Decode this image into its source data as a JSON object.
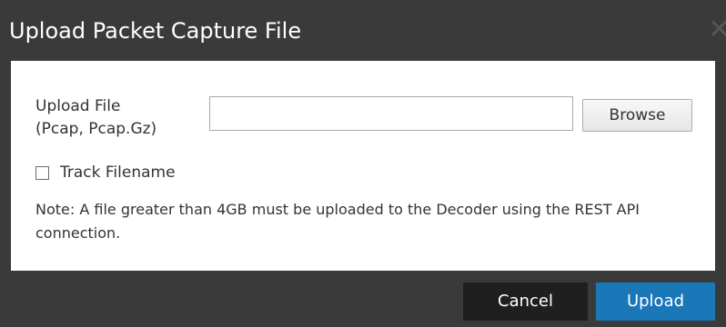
{
  "dialog": {
    "title": "Upload Packet Capture File",
    "close_icon": "close-icon",
    "close_glyph": "✕"
  },
  "form": {
    "upload_label_line1": "Upload File",
    "upload_label_line2": "(Pcap, Pcap.Gz)",
    "file_value": "",
    "browse_label": "Browse",
    "track_filename_label": "Track Filename",
    "track_filename_checked": false,
    "note": "Note: A file greater than 4GB must be uploaded to the Decoder using the REST API connection."
  },
  "footer": {
    "cancel_label": "Cancel",
    "upload_label": "Upload"
  },
  "colors": {
    "title_bar": "#3a3a3a",
    "body": "#ffffff",
    "cancel_button": "#1f1f1f",
    "upload_button": "#1a77b8"
  }
}
